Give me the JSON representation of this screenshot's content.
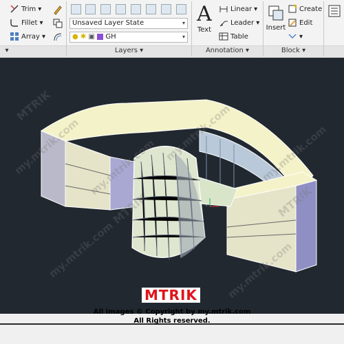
{
  "ribbon": {
    "modify": {
      "trim": "Trim",
      "fillet": "Fillet",
      "array": "Array"
    },
    "layers": {
      "layer_state": "Unsaved Layer State",
      "current_layer": "GH",
      "panel_title": "Layers"
    },
    "annotation": {
      "text": "Text",
      "linear": "Linear",
      "leader": "Leader",
      "table": "Table",
      "panel_title": "Annotation"
    },
    "block": {
      "insert": "Insert",
      "create": "Create",
      "edit": "Edit",
      "panel_title": "Block"
    },
    "dropdown_arrow": "▾",
    "layer_color": "#8a4fd6"
  },
  "watermark": {
    "logo": "MTRIK",
    "copyright_line1": "All images © Copyright by my.mtrik.com",
    "copyright_line2": "All Rights reserved.",
    "site": "my.mtrik.com",
    "brand_color": "#e0141b"
  },
  "viewport": {
    "background": "#212830"
  }
}
